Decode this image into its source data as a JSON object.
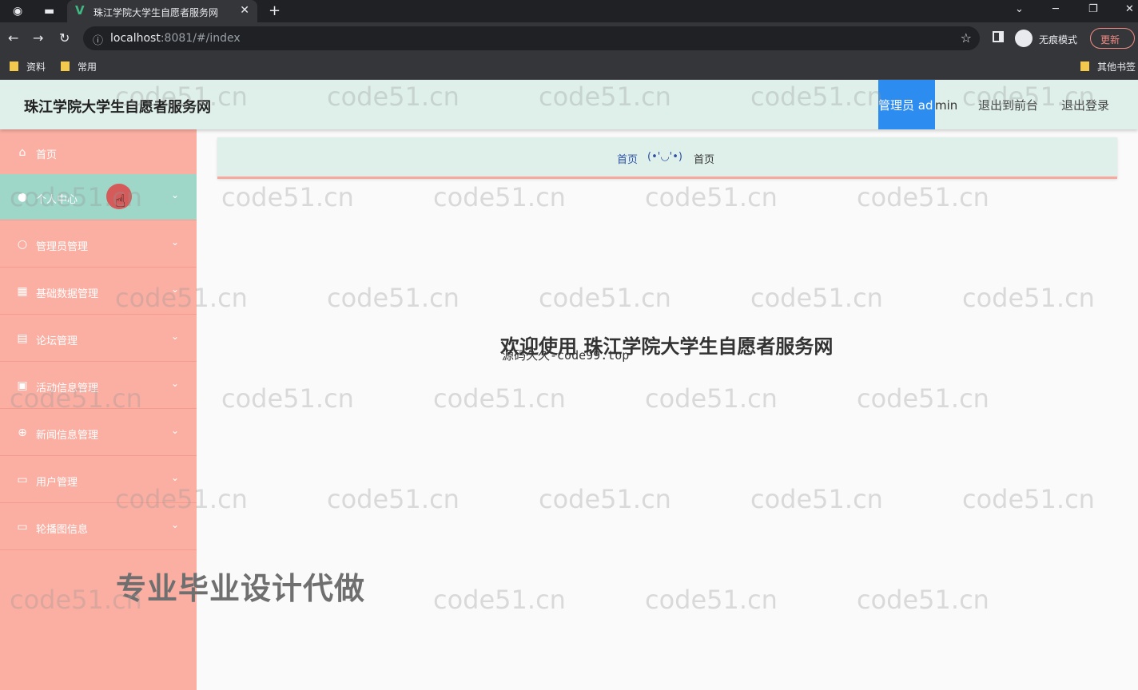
{
  "browser": {
    "tab_title": "珠江学院大学生自愿者服务网",
    "url_host": "localhost",
    "url_rest": ":8081/#/index",
    "incognito_label": "无痕模式",
    "update_label": "更新",
    "bookmarks": [
      "资料",
      "常用"
    ],
    "other_bookmarks": "其他书签"
  },
  "header": {
    "site_title": "珠江学院大学生自愿者服务网",
    "role_label": "管理员 ad",
    "user_rest": "min",
    "link_front": "退出到前台",
    "link_logout": "退出登录"
  },
  "sidebar": {
    "items": [
      {
        "label": "首页",
        "icon": "home-icon"
      },
      {
        "label": "个人中心",
        "icon": "user-icon"
      },
      {
        "label": "管理员管理",
        "icon": "circle-icon"
      },
      {
        "label": "基础数据管理",
        "icon": "grid-icon"
      },
      {
        "label": "论坛管理",
        "icon": "forum-icon"
      },
      {
        "label": "活动信息管理",
        "icon": "calendar-icon"
      },
      {
        "label": "新闻信息管理",
        "icon": "globe-icon"
      },
      {
        "label": "用户管理",
        "icon": "folder-icon"
      },
      {
        "label": "轮播图信息",
        "icon": "image-icon"
      }
    ]
  },
  "main": {
    "breadcrumb_home": "首页",
    "breadcrumb_emoji": "(•'◡'•)",
    "breadcrumb_current": "首页",
    "welcome": "欢迎使用 珠江学院大学生自愿者服务网",
    "overlay_text": "源码久久-code99.top"
  },
  "overlays": {
    "watermark": "code51.cn",
    "promo": "专业毕业设计代做"
  },
  "colors": {
    "sidebar_bg": "#fbafa3",
    "header_bg": "#dff0ea",
    "active_item": "#9ed6c8",
    "admin_highlight": "#2d8cf0"
  }
}
